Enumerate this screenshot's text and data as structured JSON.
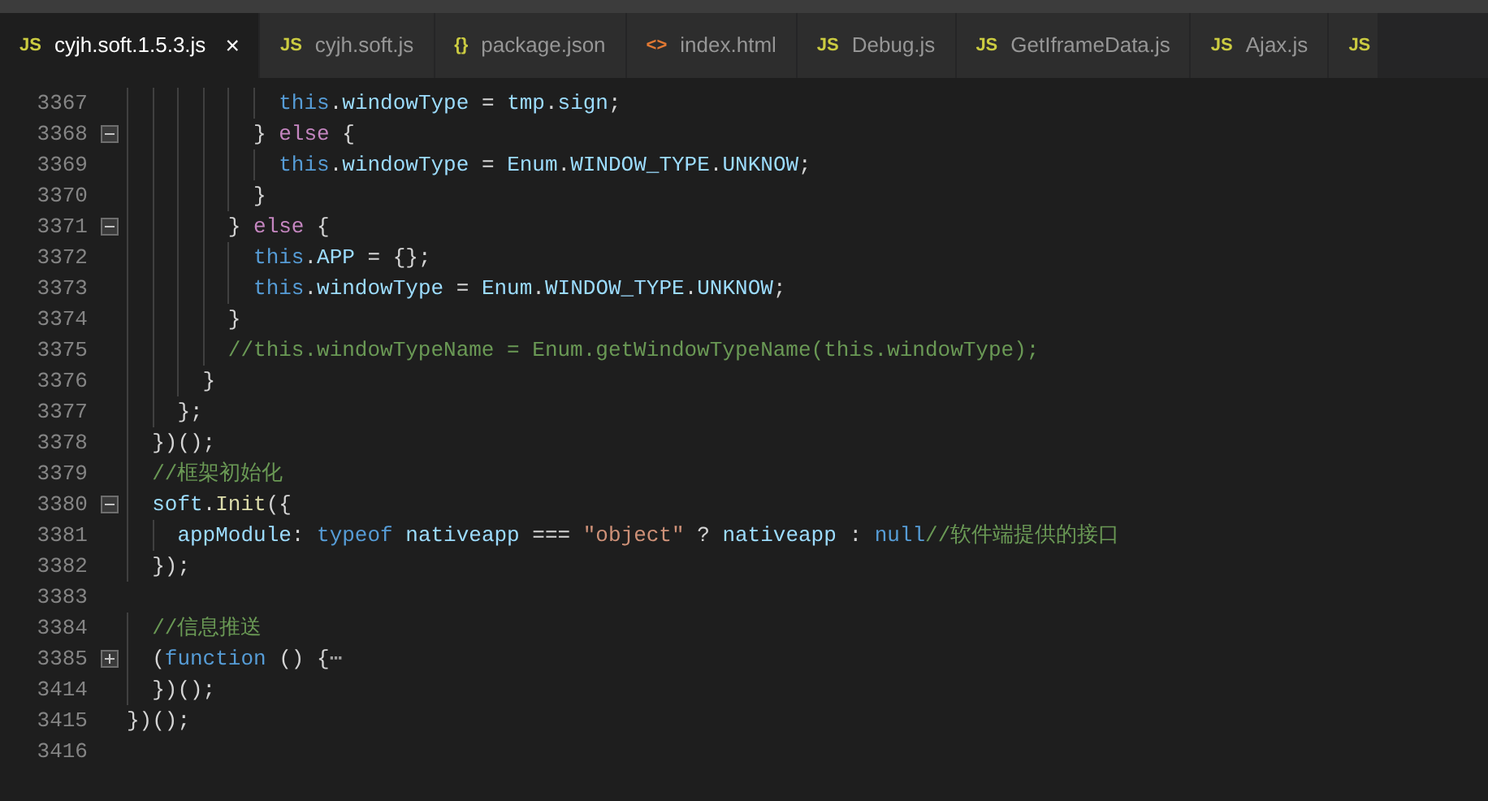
{
  "tabs": [
    {
      "icon": "JS",
      "color": "#cbcb41",
      "label": "cyjh.soft.1.5.3.js",
      "selected": true,
      "close": "×"
    },
    {
      "icon": "JS",
      "color": "#cbcb41",
      "label": "cyjh.soft.js",
      "selected": false
    },
    {
      "icon": "{}",
      "color": "#cbcb41",
      "label": "package.json",
      "selected": false
    },
    {
      "icon": "<>",
      "color": "#e37933",
      "label": "index.html",
      "selected": false
    },
    {
      "icon": "JS",
      "color": "#cbcb41",
      "label": "Debug.js",
      "selected": false
    },
    {
      "icon": "JS",
      "color": "#cbcb41",
      "label": "GetIframeData.js",
      "selected": false
    },
    {
      "icon": "JS",
      "color": "#cbcb41",
      "label": "Ajax.js",
      "selected": false
    },
    {
      "icon": "JS",
      "color": "#cbcb41",
      "selected": false
    }
  ],
  "lines": [
    {
      "number": "3367",
      "tokens": [
        {
          "kind": "keyword",
          "text": "            this"
        },
        {
          "kind": "plain",
          "text": "."
        },
        {
          "kind": "variable",
          "text": "windowType"
        },
        {
          "kind": "plain",
          "text": " = "
        },
        {
          "kind": "variable",
          "text": "tmp"
        },
        {
          "kind": "plain",
          "text": "."
        },
        {
          "kind": "variable",
          "text": "sign"
        },
        {
          "kind": "plain",
          "text": ";"
        }
      ]
    },
    {
      "number": "3368",
      "folded": false,
      "tokens": [
        {
          "kind": "plain",
          "text": "          } "
        },
        {
          "kind": "control",
          "text": "else"
        },
        {
          "kind": "plain",
          "text": " {"
        }
      ]
    },
    {
      "number": "3369",
      "tokens": [
        {
          "kind": "keyword",
          "text": "            this"
        },
        {
          "kind": "plain",
          "text": "."
        },
        {
          "kind": "variable",
          "text": "windowType"
        },
        {
          "kind": "plain",
          "text": " = "
        },
        {
          "kind": "variable",
          "text": "Enum"
        },
        {
          "kind": "plain",
          "text": "."
        },
        {
          "kind": "variable",
          "text": "WINDOW_TYPE"
        },
        {
          "kind": "plain",
          "text": "."
        },
        {
          "kind": "variable",
          "text": "UNKNOW"
        },
        {
          "kind": "plain",
          "text": ";"
        }
      ]
    },
    {
      "number": "3370",
      "tokens": [
        {
          "kind": "plain",
          "text": "          }"
        }
      ]
    },
    {
      "number": "3371",
      "folded": false,
      "tokens": [
        {
          "kind": "plain",
          "text": "        } "
        },
        {
          "kind": "control",
          "text": "else"
        },
        {
          "kind": "plain",
          "text": " {"
        }
      ]
    },
    {
      "number": "3372",
      "tokens": [
        {
          "kind": "keyword",
          "text": "          this"
        },
        {
          "kind": "plain",
          "text": "."
        },
        {
          "kind": "variable",
          "text": "APP"
        },
        {
          "kind": "plain",
          "text": " = {};"
        }
      ]
    },
    {
      "number": "3373",
      "tokens": [
        {
          "kind": "keyword",
          "text": "          this"
        },
        {
          "kind": "plain",
          "text": "."
        },
        {
          "kind": "variable",
          "text": "windowType"
        },
        {
          "kind": "plain",
          "text": " = "
        },
        {
          "kind": "variable",
          "text": "Enum"
        },
        {
          "kind": "plain",
          "text": "."
        },
        {
          "kind": "variable",
          "text": "WINDOW_TYPE"
        },
        {
          "kind": "plain",
          "text": "."
        },
        {
          "kind": "variable",
          "text": "UNKNOW"
        },
        {
          "kind": "plain",
          "text": ";"
        }
      ]
    },
    {
      "number": "3374",
      "tokens": [
        {
          "kind": "plain",
          "text": "        }"
        }
      ]
    },
    {
      "number": "3375",
      "tokens": [
        {
          "kind": "comment",
          "text": "        //this.windowTypeName = Enum.getWindowTypeName(this.windowType);"
        }
      ]
    },
    {
      "number": "3376",
      "tokens": [
        {
          "kind": "plain",
          "text": "      }"
        }
      ]
    },
    {
      "number": "3377",
      "tokens": [
        {
          "kind": "plain",
          "text": "    };"
        }
      ]
    },
    {
      "number": "3378",
      "tokens": [
        {
          "kind": "plain",
          "text": "  })();"
        }
      ]
    },
    {
      "number": "3379",
      "tokens": [
        {
          "kind": "comment",
          "text": "  //框架初始化"
        }
      ]
    },
    {
      "number": "3380",
      "folded": false,
      "tokens": [
        {
          "kind": "variable",
          "text": "  soft"
        },
        {
          "kind": "plain",
          "text": "."
        },
        {
          "kind": "function",
          "text": "Init"
        },
        {
          "kind": "plain",
          "text": "({"
        }
      ]
    },
    {
      "number": "3381",
      "tokens": [
        {
          "kind": "variable",
          "text": "    appModule"
        },
        {
          "kind": "plain",
          "text": ": "
        },
        {
          "kind": "keyword",
          "text": "typeof"
        },
        {
          "kind": "variable",
          "text": " nativeapp"
        },
        {
          "kind": "plain",
          "text": " === "
        },
        {
          "kind": "string",
          "text": "\"object\""
        },
        {
          "kind": "plain",
          "text": " ? "
        },
        {
          "kind": "variable",
          "text": "nativeapp"
        },
        {
          "kind": "plain",
          "text": " : "
        },
        {
          "kind": "keyword",
          "text": "null"
        },
        {
          "kind": "comment",
          "text": "//软件端提供的接口"
        }
      ]
    },
    {
      "number": "3382",
      "tokens": [
        {
          "kind": "plain",
          "text": "  });"
        }
      ]
    },
    {
      "number": "3383"
    },
    {
      "number": "3384",
      "tokens": [
        {
          "kind": "comment",
          "text": "  //信息推送"
        }
      ]
    },
    {
      "number": "3385",
      "folded": true,
      "tokens": [
        {
          "kind": "plain",
          "text": "  ("
        },
        {
          "kind": "keyword",
          "text": "function"
        },
        {
          "kind": "plain",
          "text": " () {"
        },
        {
          "kind": "ellipsis",
          "text": "⋯"
        }
      ]
    },
    {
      "number": "3414",
      "tokens": [
        {
          "kind": "plain",
          "text": "  })();"
        }
      ]
    },
    {
      "number": "3415",
      "tokens": [
        {
          "kind": "plain",
          "text": "})();"
        }
      ]
    },
    {
      "number": "3416"
    }
  ]
}
